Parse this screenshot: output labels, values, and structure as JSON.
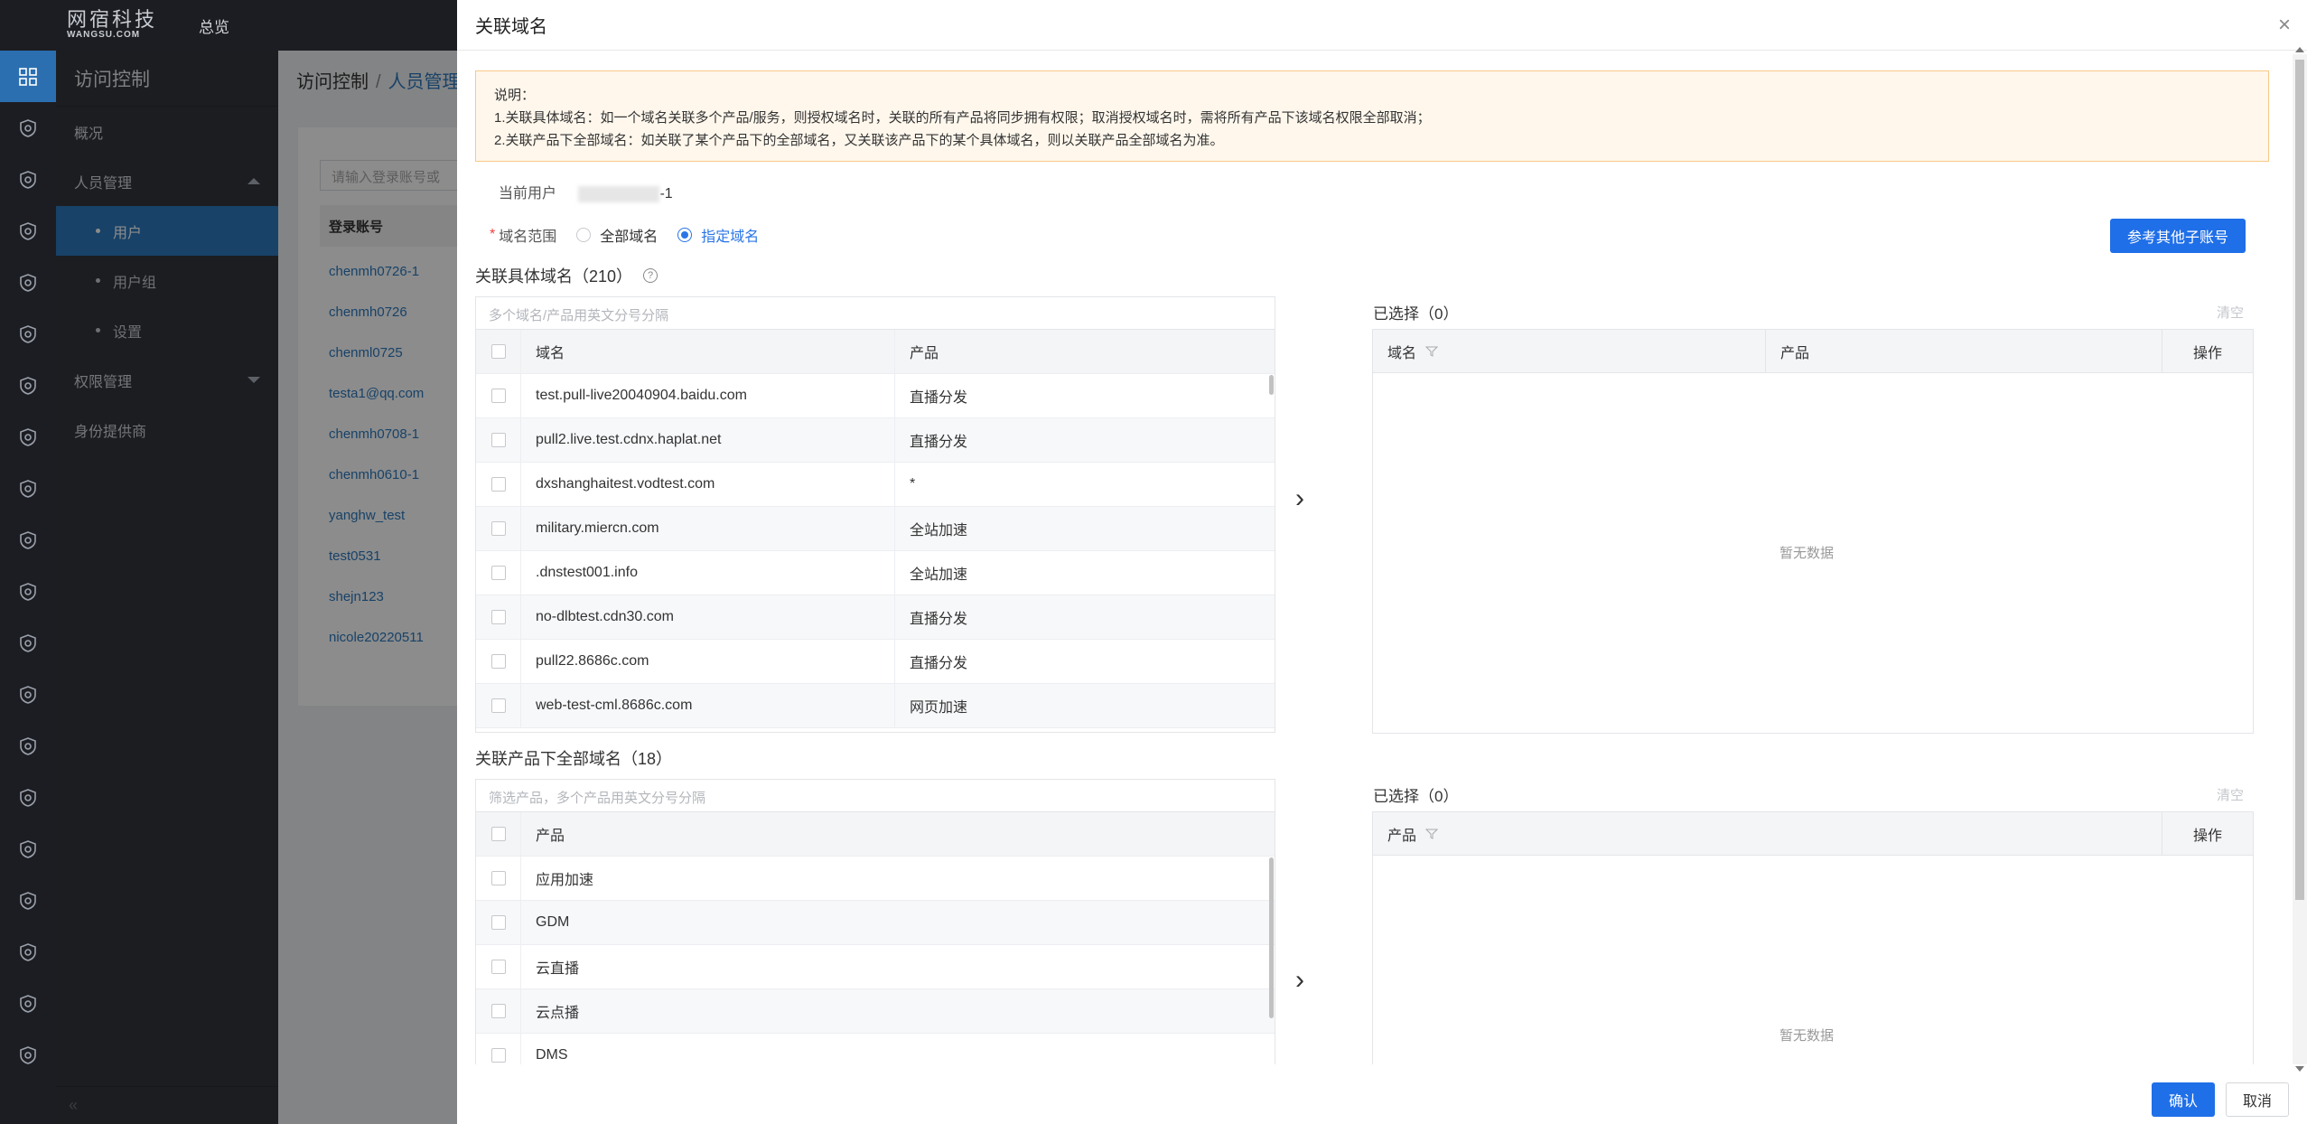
{
  "topbar": {
    "brand_cn": "网宿科技",
    "brand_en": "WANGSU.COM",
    "overview": "总览"
  },
  "rail_icons": [
    "grid-icon",
    "shield-icon",
    "badge-icon",
    "cluster-icon",
    "cluster-icon-2",
    "cluster-icon-3",
    "badge-icon-2",
    "badge-icon-3",
    "shield-check-icon",
    "monitor-icon",
    "gauge-icon",
    "database-icon",
    "chart-icon",
    "cloud-lock-icon",
    "terminal-icon",
    "drive-icon",
    "search-box-icon",
    "cloud-gear-icon",
    "w-icon",
    "shield-alt-icon"
  ],
  "sidebar": {
    "title": "访问控制",
    "items": [
      {
        "label": "概况"
      },
      {
        "label": "人员管理"
      },
      {
        "label": "用户"
      },
      {
        "label": "用户组"
      },
      {
        "label": "设置"
      },
      {
        "label": "权限管理"
      },
      {
        "label": "身份提供商"
      }
    ],
    "collapse": "«"
  },
  "background": {
    "crumb_root": "访问控制",
    "crumb_sep": "/",
    "crumb_current": "人员管理",
    "search_placeholder": "请输入登录账号或",
    "table_header": "登录账号",
    "accounts": [
      "chenmh0726-1",
      "chenmh0726",
      "chenml0725",
      "testa1@qq.com",
      "chenmh0708-1",
      "chenmh0610-1",
      "yanghw_test",
      "test0531",
      "shejn123",
      "nicole20220511"
    ]
  },
  "drawer": {
    "title": "关联域名",
    "close": "×",
    "notice": {
      "line1": "说明：",
      "line2": "1.关联具体域名：如一个域名关联多个产品/服务，则授权域名时，关联的所有产品将同步拥有权限；取消授权域名时，需将所有产品下该域名权限全部取消；",
      "line3": "2.关联产品下全部域名：如关联了某个产品下的全部域名，又关联该产品下的某个具体域名，则以关联产品全部域名为准。"
    },
    "current_user_label": "当前用户",
    "current_user_suffix": "-1",
    "scope_required": "*",
    "scope_label": "域名范围",
    "scope_all": "全部域名",
    "scope_specified": "指定域名",
    "ref_button": "参考其他子账号",
    "domains_section": {
      "title": "关联具体域名（210）",
      "help": "?",
      "search_placeholder": "多个域名/产品用英文分号分隔",
      "col_domain": "域名",
      "col_product": "产品",
      "rows": [
        {
          "domain": "test.pull-live20040904.baidu.com",
          "product": "直播分发"
        },
        {
          "domain": "pull2.live.test.cdnx.haplat.net",
          "product": "直播分发"
        },
        {
          "domain": "dxshanghaitest.vodtest.com",
          "product": "*"
        },
        {
          "domain": "military.miercn.com",
          "product": "全站加速"
        },
        {
          "domain": ".dnstest001.info",
          "product": "全站加速"
        },
        {
          "domain": "no-dlbtest.cdn30.com",
          "product": "直播分发"
        },
        {
          "domain": "pull22.8686c.com",
          "product": "直播分发"
        },
        {
          "domain": "web-test-cml.8686c.com",
          "product": "网页加速"
        }
      ]
    },
    "selected_domains": {
      "title": "已选择（0）",
      "clear": "清空",
      "col_domain": "域名",
      "col_product": "产品",
      "col_action": "操作",
      "empty": "暂无数据"
    },
    "products_section": {
      "title": "关联产品下全部域名（18）",
      "search_placeholder": "筛选产品，多个产品用英文分号分隔",
      "col_product": "产品",
      "rows": [
        {
          "product": "应用加速"
        },
        {
          "product": "GDM"
        },
        {
          "product": "云直播"
        },
        {
          "product": "云点播"
        },
        {
          "product": "DMS"
        }
      ]
    },
    "selected_products": {
      "title": "已选择（0）",
      "clear": "清空",
      "col_product": "产品",
      "col_action": "操作",
      "empty": "暂无数据"
    },
    "transfer_arrow": "›",
    "ok_button": "确认",
    "cancel_button": "取消"
  }
}
